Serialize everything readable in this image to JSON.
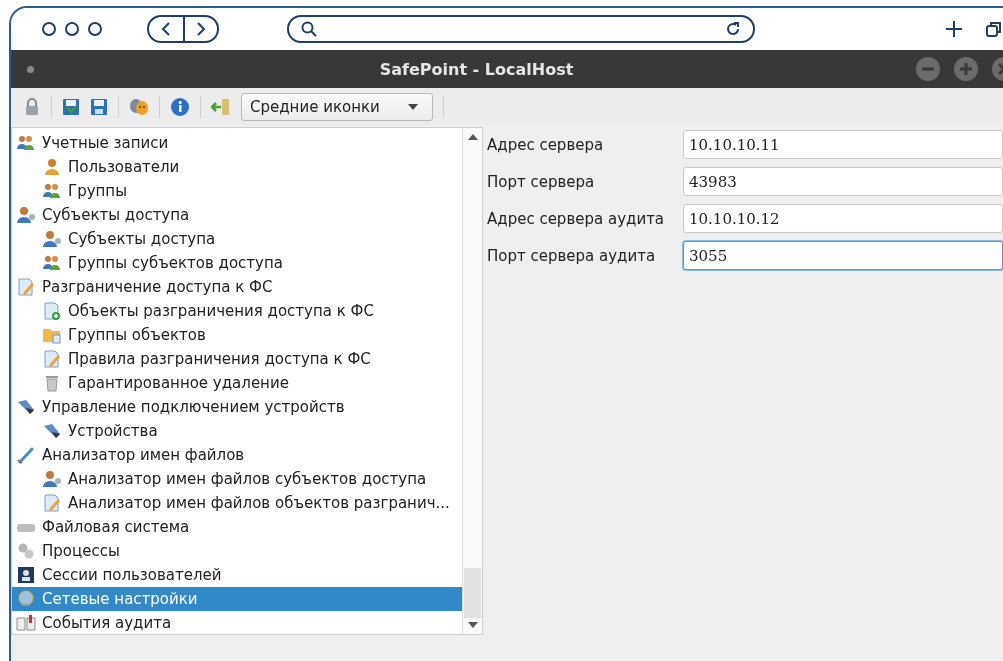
{
  "window": {
    "title": "SafePoint - LocalHost"
  },
  "toolbar": {
    "view_mode": "Средние иконки"
  },
  "tree": [
    {
      "label": "Учетные записи",
      "selected": false,
      "children": [
        {
          "label": "Пользователи",
          "selected": false
        },
        {
          "label": "Группы",
          "selected": false
        }
      ]
    },
    {
      "label": "Субъекты доступа",
      "selected": false,
      "children": [
        {
          "label": "Субъекты доступа",
          "selected": false
        },
        {
          "label": "Группы субъектов доступа",
          "selected": false
        }
      ]
    },
    {
      "label": "Разграничение доступа к ФС",
      "selected": false,
      "children": [
        {
          "label": "Объекты разграничения доступа к ФС",
          "selected": false
        },
        {
          "label": "Группы объектов",
          "selected": false
        },
        {
          "label": "Правила разграничения доступа к ФС",
          "selected": false
        },
        {
          "label": "Гарантированное удаление",
          "selected": false
        }
      ]
    },
    {
      "label": "Управление подключением устройств",
      "selected": false,
      "children": [
        {
          "label": "Устройства",
          "selected": false
        }
      ]
    },
    {
      "label": "Анализатор имен файлов",
      "selected": false,
      "children": [
        {
          "label": "Анализатор имен файлов субъектов доступа",
          "selected": false
        },
        {
          "label": "Анализатор имен файлов объектов разгранич...",
          "selected": false
        }
      ]
    },
    {
      "label": "Файловая система",
      "selected": false
    },
    {
      "label": "Процессы",
      "selected": false
    },
    {
      "label": "Сессии пользователей",
      "selected": false
    },
    {
      "label": "Сетевые настройки",
      "selected": true
    },
    {
      "label": "События аудита",
      "selected": false
    }
  ],
  "settings": [
    {
      "label": "Адрес сервера",
      "value": "10.10.10.11",
      "focused": false
    },
    {
      "label": "Порт сервера",
      "value": "43983",
      "focused": false
    },
    {
      "label": "Адрес сервера аудита",
      "value": "10.10.10.12",
      "focused": false
    },
    {
      "label": "Порт сервера аудита",
      "value": "3055",
      "focused": true
    }
  ]
}
